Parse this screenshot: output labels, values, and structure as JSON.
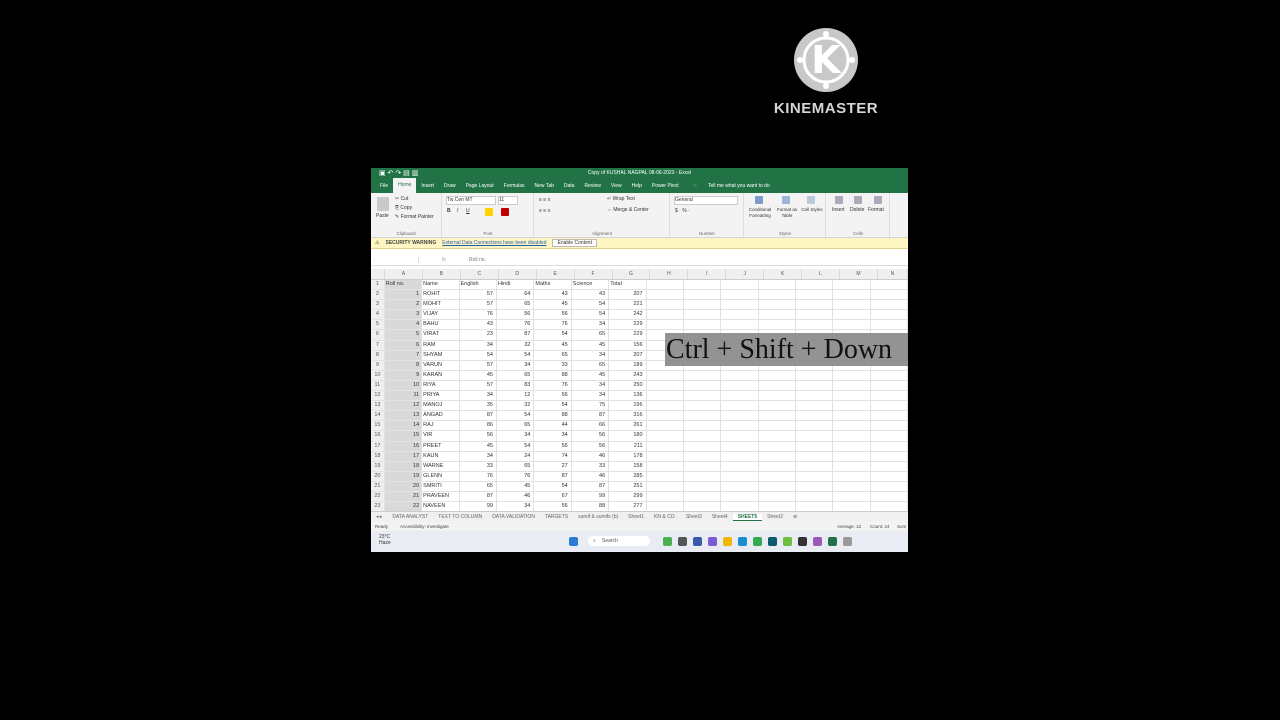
{
  "logo": {
    "letter": "K",
    "text": "KINEMASTER"
  },
  "overlay": {
    "text": "Ctrl + Shift + Down"
  },
  "excel": {
    "title": "Copy of KUSHAL NAGPAL 08-06-2023 - Excel",
    "tabs": [
      "File",
      "Home",
      "Insert",
      "Draw",
      "Page Layout",
      "Formulas",
      "New Tab",
      "Data",
      "Review",
      "View",
      "Help",
      "Power Pivot"
    ],
    "tell_me": "Tell me what you want to do",
    "ribbon": {
      "clipboard": {
        "paste": "Paste",
        "cut": "Cut",
        "copy": "Copy",
        "format_painter": "Format Painter",
        "label": "Clipboard"
      },
      "font": {
        "name": "Tw Cen MT",
        "size": "11",
        "label": "Font"
      },
      "alignment": {
        "wrap": "Wrap Text",
        "merge": "Merge & Center",
        "label": "Alignment"
      },
      "number": {
        "format": "General",
        "label": "Number"
      },
      "styles": {
        "conditional": "Conditional Formatting",
        "format_table": "Format as Table",
        "cell_styles": "Cell Styles",
        "label": "Styles"
      },
      "cells": {
        "insert": "Insert",
        "delete": "Delete",
        "format": "Format",
        "label": "Cells"
      }
    },
    "security": {
      "warning": "SECURITY WARNING",
      "message": "External Data Connections have been disabled",
      "button": "Enable Content"
    },
    "formula_bar": {
      "fx": "fx",
      "value": "Roll no."
    },
    "columns": [
      "A",
      "B",
      "C",
      "D",
      "E",
      "F",
      "G",
      "H",
      "I",
      "J",
      "K",
      "L",
      "M",
      "N"
    ],
    "headers": [
      "Roll no.",
      "Name",
      "English",
      "Hindi",
      "Maths",
      "Science",
      "Total"
    ],
    "rows": [
      [
        "1",
        "ROHIT",
        "57",
        "64",
        "43",
        "43",
        "207"
      ],
      [
        "2",
        "MOHIT",
        "57",
        "65",
        "45",
        "54",
        "221"
      ],
      [
        "3",
        "VIJAY",
        "76",
        "56",
        "56",
        "54",
        "242"
      ],
      [
        "4",
        "BAHU",
        "43",
        "76",
        "76",
        "34",
        "229"
      ],
      [
        "5",
        "VIRAT",
        "23",
        "87",
        "54",
        "65",
        "229"
      ],
      [
        "6",
        "RAM",
        "34",
        "32",
        "45",
        "45",
        "156"
      ],
      [
        "7",
        "SHYAM",
        "54",
        "54",
        "65",
        "34",
        "207"
      ],
      [
        "8",
        "VARUN",
        "57",
        "34",
        "33",
        "65",
        "189"
      ],
      [
        "9",
        "KARAN",
        "45",
        "65",
        "88",
        "45",
        "243"
      ],
      [
        "10",
        "RIYA",
        "57",
        "83",
        "76",
        "34",
        "250"
      ],
      [
        "11",
        "PRIYA",
        "34",
        "12",
        "56",
        "34",
        "136"
      ],
      [
        "12",
        "MANOJ",
        "35",
        "32",
        "54",
        "75",
        "196"
      ],
      [
        "13",
        "ANGAD",
        "87",
        "54",
        "88",
        "87",
        "316"
      ],
      [
        "14",
        "RAJ",
        "86",
        "65",
        "44",
        "66",
        "261"
      ],
      [
        "15",
        "VIR",
        "56",
        "34",
        "34",
        "56",
        "180"
      ],
      [
        "16",
        "PREET",
        "45",
        "54",
        "56",
        "56",
        "211"
      ],
      [
        "17",
        "KAUN",
        "34",
        "24",
        "74",
        "46",
        "178"
      ],
      [
        "18",
        "WARNE",
        "33",
        "65",
        "27",
        "33",
        "158"
      ],
      [
        "19",
        "GLENN",
        "76",
        "76",
        "87",
        "46",
        "285"
      ],
      [
        "20",
        "SMRITI",
        "65",
        "45",
        "54",
        "87",
        "251"
      ],
      [
        "21",
        "PRAVEEN",
        "87",
        "46",
        "67",
        "99",
        "299"
      ],
      [
        "22",
        "NAVEEN",
        "99",
        "34",
        "56",
        "88",
        "277"
      ]
    ],
    "sheet_tabs": [
      "DATA ANALYST",
      "TEXT TO COLUMN",
      "DATA VALIDATION",
      "TARGETS",
      "sumif & sumifs (b)",
      "Sheet1",
      "KN & CO.",
      "Sheet3",
      "Sheet4",
      "SHEET5",
      "Sheet2"
    ],
    "active_sheet": "SHEET5",
    "status": {
      "ready": "Ready",
      "accessibility": "Accessibility: Investigate",
      "average": "Average: 12",
      "count": "Count: 24",
      "sum": "Sum"
    }
  },
  "taskbar": {
    "temp": "23°C",
    "weather": "Haze",
    "search": "Search"
  },
  "colors": {
    "excel_green": "#217346",
    "security_bg": "#fdf6c3"
  }
}
